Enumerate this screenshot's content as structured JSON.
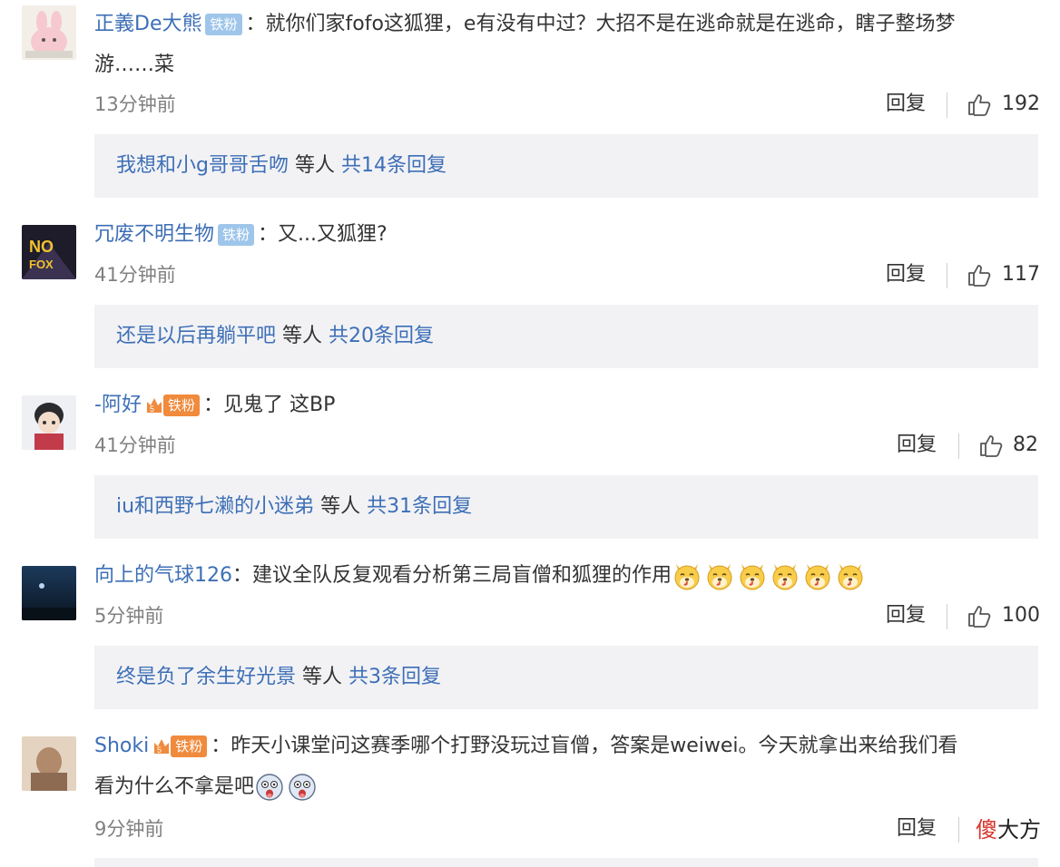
{
  "comments": [
    {
      "username": "正義De大熊",
      "badge": "铁粉",
      "badge_style": "plain",
      "colon": "：",
      "text": "就你们家fofo这狐狸，e有没有中过？大招不是在逃命就是在逃命，瞎子整场梦",
      "text_line2": "游……菜",
      "time": "13分钟前",
      "reply_label": "回复",
      "likes": "192",
      "sub_user": "我想和小g哥哥舌吻",
      "sub_mid": "等人",
      "sub_total": "共14条回复"
    },
    {
      "username": "冗废不明生物",
      "badge": "铁粉",
      "badge_style": "plain",
      "colon": "：",
      "text": "又...又狐狸?",
      "time": "41分钟前",
      "reply_label": "回复",
      "likes": "117",
      "sub_user": "还是以后再躺平吧",
      "sub_mid": "等人",
      "sub_total": "共20条回复"
    },
    {
      "username": "-阿好",
      "badge": "铁粉",
      "badge_style": "crown",
      "colon": "：",
      "text": "见鬼了 这BP",
      "time": "41分钟前",
      "reply_label": "回复",
      "likes": "82",
      "sub_user": "iu和西野七濑的小迷弟",
      "sub_mid": "等人",
      "sub_total": "共31条回复"
    },
    {
      "username": "向上的气球126",
      "colon": "：",
      "text": "建议全队反复观看分析第三局盲僧和狐狸的作用",
      "time": "5分钟前",
      "reply_label": "回复",
      "likes": "100",
      "sub_user": "终是负了余生好光景",
      "sub_mid": "等人",
      "sub_total": "共3条回复"
    },
    {
      "username": "Shoki",
      "badge": "铁粉",
      "badge_style": "crown",
      "colon": "：",
      "text": "昨天小课堂问这赛季哪个打野没玩过盲僧，答案是weiwei。今天就拿出来给我们看",
      "text_line2": "看为什么不拿是吧",
      "time": "9分钟前",
      "reply_label": "回复"
    }
  ],
  "watermark": {
    "red": "傻",
    "rest": "大方"
  },
  "icons": {
    "thumb": "thumbs-up-icon",
    "emoji_doge": "doge-emoji-icon",
    "emoji_scared": "scared-emoji-icon"
  },
  "colors": {
    "link": "#3d6fb6",
    "subbox": "#f2f2f5",
    "badge": "#9fc6ea"
  }
}
